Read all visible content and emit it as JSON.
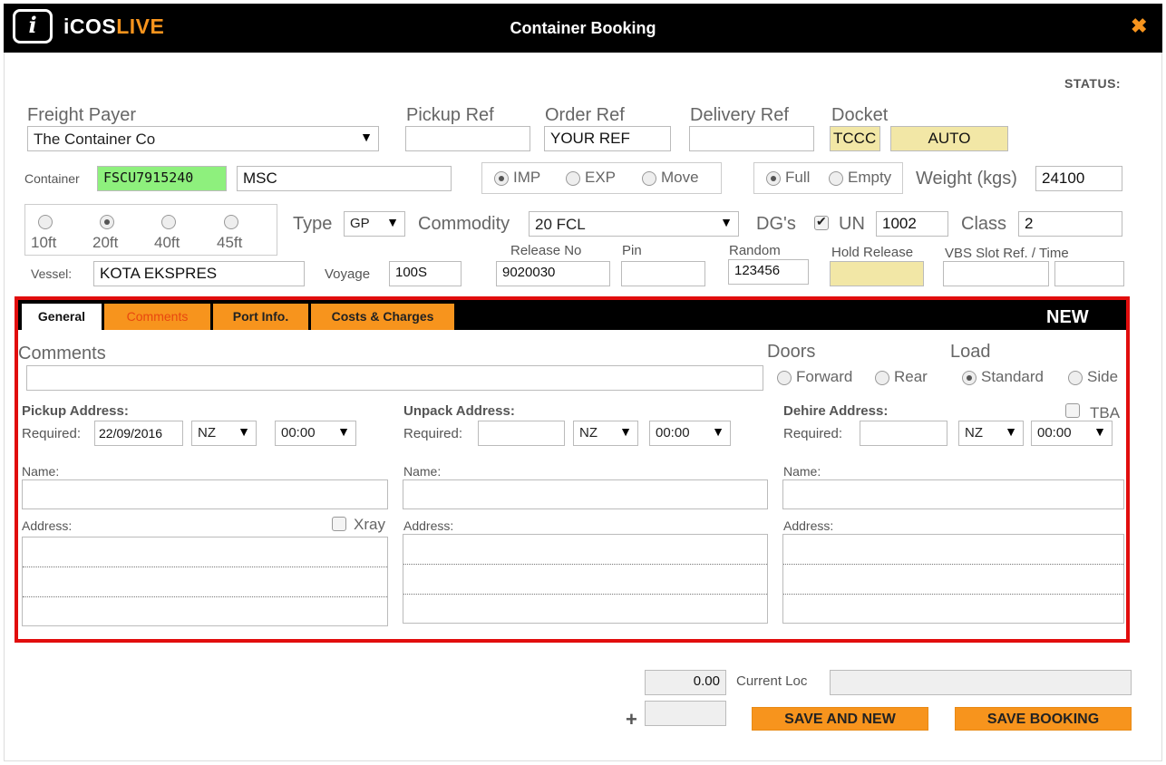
{
  "app": {
    "brand_prefix": "iCOS",
    "brand_suffix": "LIVE",
    "window_title": "Container Booking",
    "close_glyph": "✖"
  },
  "status": {
    "label": "STATUS:"
  },
  "header": {
    "freight_payer": {
      "label": "Freight Payer",
      "value": "The Container Co"
    },
    "pickup_ref": {
      "label": "Pickup Ref",
      "value": ""
    },
    "order_ref": {
      "label": "Order Ref",
      "value": "YOUR REF"
    },
    "delivery_ref": {
      "label": "Delivery Ref",
      "value": ""
    },
    "docket": {
      "label": "Docket",
      "value": "TCCC",
      "auto": "AUTO"
    }
  },
  "container": {
    "label": "Container",
    "number": "FSCU7915240",
    "line": "MSC",
    "direction": {
      "options": [
        "IMP",
        "EXP",
        "Move"
      ],
      "selected": "IMP"
    },
    "fill": {
      "options": [
        "Full",
        "Empty"
      ],
      "selected": "Full"
    },
    "weight": {
      "label": "Weight (kgs)",
      "value": "24100"
    },
    "sizes": {
      "options": [
        "10ft",
        "20ft",
        "40ft",
        "45ft"
      ],
      "selected": "20ft"
    },
    "type": {
      "label": "Type",
      "value": "GP"
    },
    "commodity": {
      "label": "Commodity",
      "value": "20 FCL"
    },
    "dgs": {
      "label": "DG's",
      "checked": true,
      "un_label": "UN",
      "un_value": "1002",
      "class_label": "Class",
      "class_value": "2"
    }
  },
  "vessel": {
    "label": "Vessel:",
    "value": "KOTA EKSPRES",
    "voyage_label": "Voyage",
    "voyage_value": "100S",
    "release_label": "Release No",
    "release_value": "9020030",
    "pin_label": "Pin",
    "pin_value": "",
    "random_label": "Random",
    "random_value": "123456",
    "hold_label": "Hold Release",
    "hold_value": "",
    "vbs_label": "VBS Slot Ref. / Time",
    "vbs_ref": "",
    "vbs_time": ""
  },
  "tabs": [
    {
      "label": "General",
      "active": true
    },
    {
      "label": "Comments",
      "active": false
    },
    {
      "label": "Port Info.",
      "active": false
    },
    {
      "label": "Costs & Charges",
      "active": false
    }
  ],
  "tab_status": "NEW",
  "general": {
    "comments_label": "Comments",
    "comments_value": "",
    "doors": {
      "label": "Doors",
      "options": [
        "Forward",
        "Rear"
      ],
      "selected": ""
    },
    "load": {
      "label": "Load",
      "options": [
        "Standard",
        "Side"
      ],
      "selected": "Standard"
    },
    "pickup": {
      "title": "Pickup Address:",
      "required_label": "Required:",
      "date": "22/09/2016",
      "region": "NZ",
      "time": "00:00",
      "name_label": "Name:",
      "name_value": "",
      "address_label": "Address:",
      "xray_label": "Xray",
      "xray_checked": false
    },
    "unpack": {
      "title": "Unpack Address:",
      "required_label": "Required:",
      "date": "",
      "region": "NZ",
      "time": "00:00",
      "name_label": "Name:",
      "name_value": "",
      "address_label": "Address:"
    },
    "dehire": {
      "title": "Dehire Address:",
      "required_label": "Required:",
      "date": "",
      "region": "NZ",
      "time": "00:00",
      "name_label": "Name:",
      "name_value": "",
      "address_label": "Address:",
      "tba_label": "TBA",
      "tba_checked": false
    }
  },
  "footer": {
    "amount": "0.00",
    "current_loc_label": "Current Loc",
    "current_loc_value": "",
    "plus": "+",
    "extra_value": "",
    "save_new_label": "SAVE AND NEW",
    "save_booking_label": "SAVE BOOKING"
  }
}
